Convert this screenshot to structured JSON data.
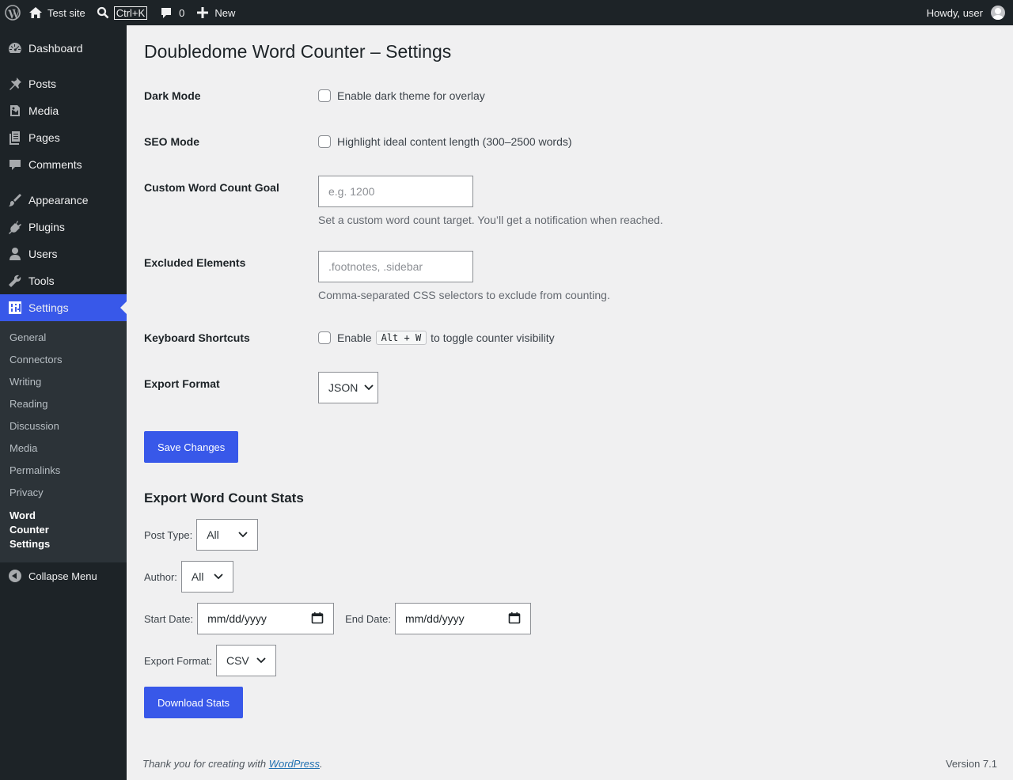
{
  "adminbar": {
    "site_name": "Test site",
    "search_shortcut": "Ctrl+K",
    "comments_count": "0",
    "new_label": "New",
    "greeting": "Howdy, user"
  },
  "sidebar": {
    "items": [
      {
        "label": "Dashboard",
        "icon": "dashboard-icon"
      },
      {
        "label": "Posts",
        "icon": "pin-icon"
      },
      {
        "label": "Media",
        "icon": "media-icon"
      },
      {
        "label": "Pages",
        "icon": "pages-icon"
      },
      {
        "label": "Comments",
        "icon": "comment-icon"
      },
      {
        "label": "Appearance",
        "icon": "brush-icon"
      },
      {
        "label": "Plugins",
        "icon": "plug-icon"
      },
      {
        "label": "Users",
        "icon": "user-icon"
      },
      {
        "label": "Tools",
        "icon": "wrench-icon"
      },
      {
        "label": "Settings",
        "icon": "settings-icon"
      }
    ],
    "submenu": [
      "General",
      "Connectors",
      "Writing",
      "Reading",
      "Discussion",
      "Media",
      "Permalinks",
      "Privacy",
      "Word Counter Settings"
    ],
    "collapse_label": "Collapse Menu"
  },
  "page": {
    "title": "Doubledome Word Counter – Settings"
  },
  "settings": {
    "dark_mode": {
      "label": "Dark Mode",
      "checkbox_label": "Enable dark theme for overlay"
    },
    "seo_mode": {
      "label": "SEO Mode",
      "checkbox_label": "Highlight ideal content length (300–2500 words)"
    },
    "goal": {
      "label": "Custom Word Count Goal",
      "placeholder": "e.g. 1200",
      "description": "Set a custom word count target. You’ll get a notification when reached."
    },
    "excluded": {
      "label": "Excluded Elements",
      "placeholder": ".footnotes, .sidebar",
      "description": "Comma-separated CSS selectors to exclude from counting."
    },
    "shortcuts": {
      "label": "Keyboard Shortcuts",
      "prefix": "Enable",
      "key": "Alt + W",
      "suffix": "to toggle counter visibility"
    },
    "export_format": {
      "label": "Export Format",
      "value": "JSON"
    },
    "save_label": "Save Changes"
  },
  "export": {
    "heading": "Export Word Count Stats",
    "post_type_label": "Post Type:",
    "post_type_value": "All",
    "author_label": "Author:",
    "author_value": "All",
    "start_label": "Start Date:",
    "start_value": "mm/dd/yyyy",
    "end_label": "End Date:",
    "end_value": "mm/dd/yyyy",
    "format_label": "Export Format:",
    "format_value": "CSV",
    "download_label": "Download Stats"
  },
  "footer": {
    "thanks_prefix": "Thank you for creating with",
    "thanks_link": "WordPress",
    "thanks_suffix": ".",
    "version": "Version 7.1"
  },
  "colors": {
    "accent": "#3858e9",
    "adminbar_bg": "#1d2327",
    "page_bg": "#f0f0f1"
  }
}
